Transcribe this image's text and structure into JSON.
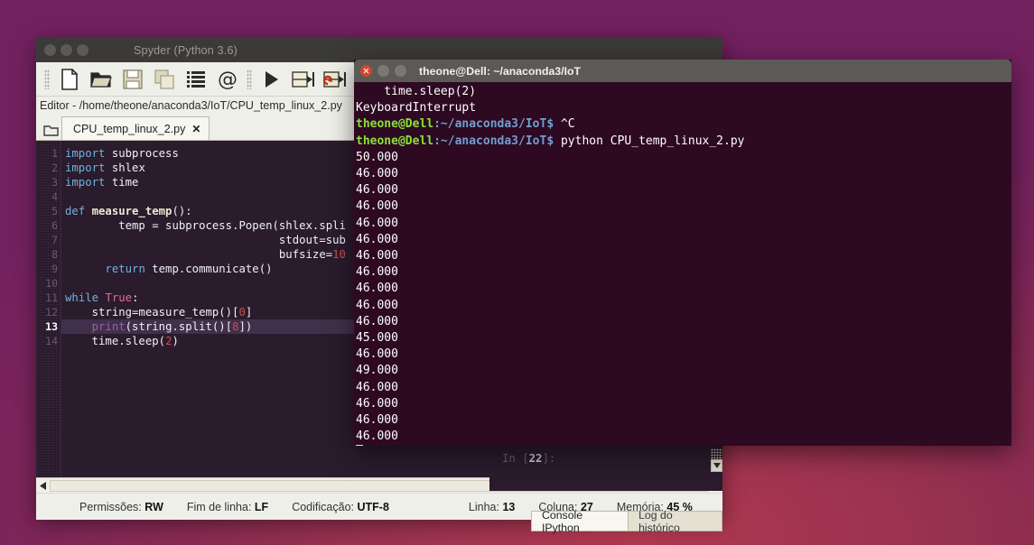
{
  "desktop": {
    "background_color": "#7a245b",
    "accent_color": "#b2384f"
  },
  "spyder": {
    "title": "Spyder (Python 3.6)",
    "window_buttons": [
      "minimize-button",
      "maximize-button",
      "close-button"
    ],
    "toolbar": [
      {
        "name": "new-file-icon",
        "label": "New file"
      },
      {
        "name": "open-file-icon",
        "label": "Open file"
      },
      {
        "name": "save-file-icon",
        "label": "Save file"
      },
      {
        "name": "save-all-icon",
        "label": "Save all"
      },
      {
        "name": "preferences-icon",
        "label": "Preferences"
      },
      {
        "name": "find-in-files-icon",
        "label": "Find in files"
      },
      {
        "name": "run-file-icon",
        "label": "Run file"
      },
      {
        "name": "run-cell-icon",
        "label": "Run cell"
      },
      {
        "name": "run-cell-advance-icon",
        "label": "Run cell and advance"
      },
      {
        "name": "run-selection-icon",
        "label": "Run selection"
      }
    ],
    "editor_header": "Editor - /home/theone/anaconda3/IoT/CPU_temp_linux_2.py",
    "tab": {
      "label": "CPU_temp_linux_2.py",
      "close": "✕"
    },
    "code_lines": [
      {
        "n": "1",
        "html": "<span class=\"kw\">import</span> subprocess"
      },
      {
        "n": "2",
        "html": "<span class=\"kw\">import</span> shlex"
      },
      {
        "n": "3",
        "html": "<span class=\"kw\">import</span> time"
      },
      {
        "n": "4",
        "html": ""
      },
      {
        "n": "5",
        "html": "<span class=\"kw\">def</span> <span class=\"fn\">measure_temp</span>():"
      },
      {
        "n": "6",
        "html": "        temp = subprocess.Popen(shlex.spli"
      },
      {
        "n": "7",
        "html": "                                stdout=sub"
      },
      {
        "n": "8",
        "html": "                                bufsize=<span class=\"num\">10</span>"
      },
      {
        "n": "9",
        "html": "      <span class=\"kw\">return</span> temp.communicate()"
      },
      {
        "n": "10",
        "html": ""
      },
      {
        "n": "11",
        "html": "<span class=\"kw\">while</span> <span class=\"kw2\">True</span>:"
      },
      {
        "n": "12",
        "html": "    string=measure_temp()[<span class=\"num\">0</span>]"
      },
      {
        "n": "13",
        "html": "    <span class=\"bi\">print</span>(string.split()[<span class=\"num\">8</span>])",
        "highlighted": true
      },
      {
        "n": "14",
        "html": "    time.sleep(<span class=\"num\">2</span>)"
      }
    ],
    "statusbar": {
      "permissions_label": "Permissões:",
      "permissions_value": "RW",
      "eol_label": "Fim de linha:",
      "eol_value": "LF",
      "encoding_label": "Codificação:",
      "encoding_value": "UTF-8",
      "line_label": "Linha:",
      "line_value": "13",
      "column_label": "Coluna:",
      "column_value": "27",
      "memory_label": "Memória:",
      "memory_value": "45 %"
    },
    "console": {
      "prompt_prefix": "In [",
      "prompt_number": "22",
      "prompt_suffix": "]:",
      "tabs": [
        {
          "label": "Console IPython",
          "active": true
        },
        {
          "label": "Log do histórico",
          "active": false
        }
      ]
    }
  },
  "terminal": {
    "title": "theone@Dell: ~/anaconda3/IoT",
    "window_buttons": [
      "close-button",
      "minimize-button",
      "maximize-button"
    ],
    "lines": [
      {
        "type": "plain",
        "text": "    time.sleep(2)"
      },
      {
        "type": "plain",
        "text": "KeyboardInterrupt"
      },
      {
        "type": "prompt",
        "user": "theone@Dell",
        "path": ":~/anaconda3/IoT$",
        "cmd": " ^C"
      },
      {
        "type": "prompt",
        "user": "theone@Dell",
        "path": ":~/anaconda3/IoT$",
        "cmd": " python CPU_temp_linux_2.py"
      },
      {
        "type": "plain",
        "text": "50.000"
      },
      {
        "type": "plain",
        "text": "46.000"
      },
      {
        "type": "plain",
        "text": "46.000"
      },
      {
        "type": "plain",
        "text": "46.000"
      },
      {
        "type": "plain",
        "text": "46.000"
      },
      {
        "type": "plain",
        "text": "46.000"
      },
      {
        "type": "plain",
        "text": "46.000"
      },
      {
        "type": "plain",
        "text": "46.000"
      },
      {
        "type": "plain",
        "text": "46.000"
      },
      {
        "type": "plain",
        "text": "46.000"
      },
      {
        "type": "plain",
        "text": "46.000"
      },
      {
        "type": "plain",
        "text": "45.000"
      },
      {
        "type": "plain",
        "text": "46.000"
      },
      {
        "type": "plain",
        "text": "49.000"
      },
      {
        "type": "plain",
        "text": "46.000"
      },
      {
        "type": "plain",
        "text": "46.000"
      },
      {
        "type": "plain",
        "text": "46.000"
      },
      {
        "type": "plain",
        "text": "46.000"
      },
      {
        "type": "cursor",
        "text": ""
      }
    ]
  }
}
